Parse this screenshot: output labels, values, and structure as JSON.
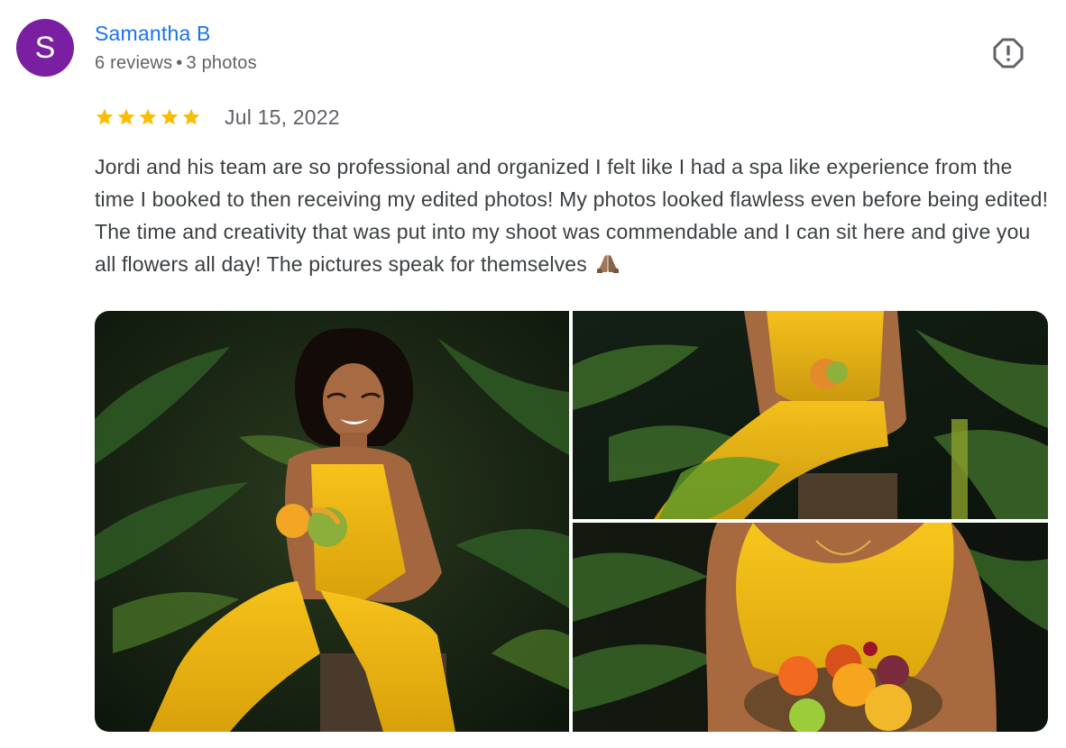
{
  "author": {
    "initial": "S",
    "name": "Samantha B",
    "reviews_count": "6 reviews",
    "separator": "•",
    "photos_count": "3 photos",
    "avatar_color": "#7b1fa2",
    "name_color": "#1a73e8"
  },
  "review": {
    "rating": 5,
    "rating_max": 5,
    "star_color": "#fbbc04",
    "date": "Jul 15, 2022",
    "text": "Jordi and his team are so professional and organized I felt like I had a spa like experience from the time I booked to then receiving my edited photos! My photos looked flawless even before being edited! The time and creativity that was put into my shoot was commendable and I can sit here and give you all flowers all day! The pictures speak for themselves",
    "emoji": "folded-hands-emoji"
  },
  "actions": {
    "report_icon": "report-icon"
  },
  "photos": [
    {
      "icon": "review-photo",
      "subject": "woman in yellow jumpsuit holding mangoes, tropical leaves"
    },
    {
      "icon": "review-photo",
      "subject": "seated woman in yellow halter top holding mango"
    },
    {
      "icon": "review-photo",
      "subject": "woman holding basket of tropical fruit"
    }
  ]
}
